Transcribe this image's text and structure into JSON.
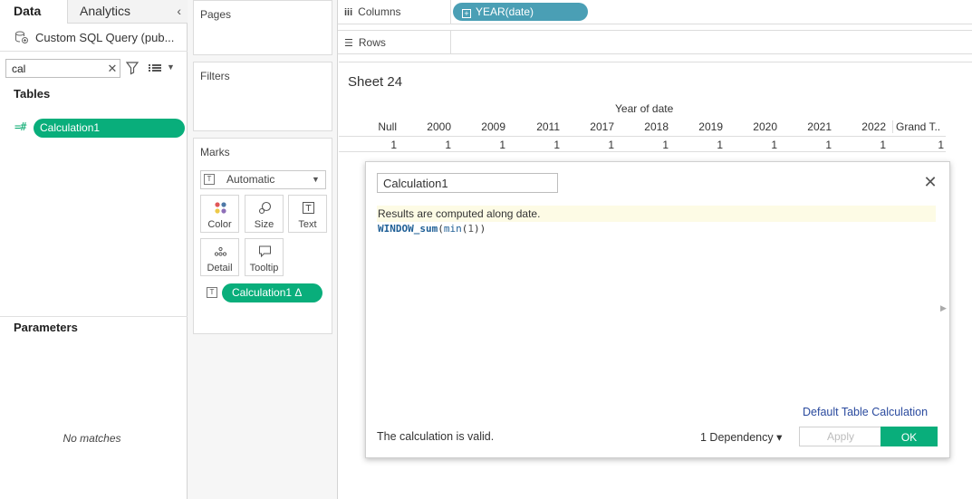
{
  "data_pane": {
    "tab_data": "Data",
    "tab_analytics": "Analytics",
    "collapse_glyph": "‹",
    "datasource": "Custom SQL Query (pub...",
    "search": {
      "value": "cal",
      "clear_glyph": "✕"
    },
    "tables_header": "Tables",
    "field_type_glyph": "=#",
    "field_name": "Calculation1",
    "parameters_header": "Parameters",
    "no_matches": "No matches"
  },
  "cards": {
    "pages": "Pages",
    "filters": "Filters",
    "marks": "Marks",
    "mark_type": "Automatic",
    "buttons": {
      "color": "Color",
      "size": "Size",
      "text": "Text",
      "detail": "Detail",
      "tooltip": "Tooltip"
    },
    "mark_field": "Calculation1  Δ"
  },
  "shelves": {
    "columns_label": "Columns",
    "columns_icon": "iii",
    "rows_label": "Rows",
    "rows_icon": "☰",
    "year_pill": "YEAR(date)",
    "year_pill_glyph": "+"
  },
  "view": {
    "sheet_title": "Sheet 24",
    "header_title": "Year of date",
    "columns": [
      "Null",
      "2000",
      "2009",
      "2011",
      "2017",
      "2018",
      "2019",
      "2020",
      "2021",
      "2022"
    ],
    "values": [
      "1",
      "1",
      "1",
      "1",
      "1",
      "1",
      "1",
      "1",
      "1",
      "1"
    ],
    "grand_total_header": "Grand T..",
    "grand_total_value": "1"
  },
  "calc_dialog": {
    "name": "Calculation1",
    "close_glyph": "✕",
    "hint": "Results are computed along date.",
    "formula_fn": "WINDOW_sum",
    "formula_open": "(",
    "formula_inner_fn": "min",
    "formula_inner_open": "(",
    "formula_arg": "1",
    "formula_close": "))",
    "expand_glyph": "▶",
    "default_table_calc": "Default Table Calculation",
    "status": "The calculation is valid.",
    "dependency": "1 Dependency ▾",
    "apply": "Apply",
    "ok": "OK"
  },
  "colors": {
    "green_pill": "#09ae7b",
    "blue_pill": "#4a9fb5",
    "link": "#2a4a9e",
    "hint_bg": "#fdfbe5"
  }
}
